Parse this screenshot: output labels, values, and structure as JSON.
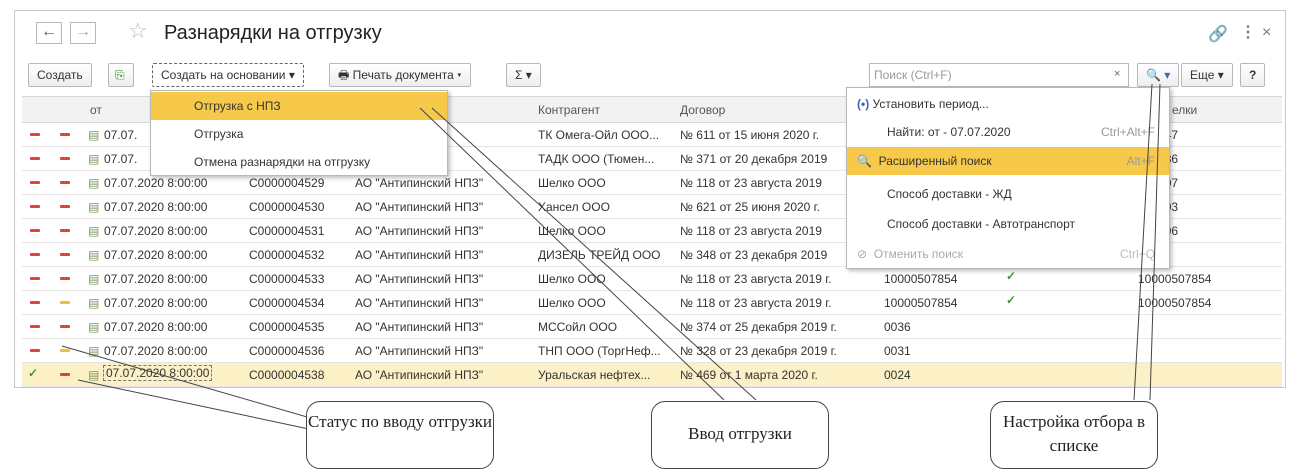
{
  "window": {
    "title": "Разнарядки на отгрузку"
  },
  "toolbar": {
    "create": "Создать",
    "create_based": "Создать на основании",
    "print": "Печать документа",
    "sum": "Σ",
    "more": "Еще",
    "help": "?"
  },
  "search": {
    "placeholder": "Поиск (Ctrl+F)"
  },
  "columns": {
    "date": "от",
    "contractor": "Контрагент",
    "contract": "Договор",
    "tail": "елки"
  },
  "rows": [
    {
      "date": "07.07.",
      "num": "",
      "org": "ский НПЗ\"",
      "contractor": "ТК Омега-Ойл ООО...",
      "contract": "№ 611 от 15 июня 2020 г.",
      "c1": "",
      "c2": "509347"
    },
    {
      "date": "07.07.",
      "num": "",
      "org": "ский НПЗ\"",
      "contractor": "ТАДК ООО (Тюмен...",
      "contract": "№ 371 от 20 декабря 2019",
      "c1": "",
      "c2": "510886"
    },
    {
      "date": "07.07.2020 8:00:00",
      "num": "C0000004529",
      "org": "АО \"Антипинский НПЗ\"",
      "contractor": "Шелко ООО",
      "contract": "№ 118 от 23 августа 2019",
      "c1": "",
      "c2": "506407"
    },
    {
      "date": "07.07.2020 8:00:00",
      "num": "C0000004530",
      "org": "АО \"Антипинский НПЗ\"",
      "contractor": "Хансел ООО",
      "contract": "№ 621 от 25 июня 2020 г.",
      "c1": "",
      "c2": "509003"
    },
    {
      "date": "07.07.2020 8:00:00",
      "num": "C0000004531",
      "org": "АО \"Антипинский НПЗ\"",
      "contractor": "Шелко ООО",
      "contract": "№ 118 от 23 августа 2019",
      "c1": "",
      "c2": "506496"
    },
    {
      "date": "07.07.2020 8:00:00",
      "num": "C0000004532",
      "org": "АО \"Антипинский НПЗ\"",
      "contractor": "ДИЗЕЛЬ ТРЕЙД ООО",
      "contract": "№ 348 от 23 декабря 2019",
      "c1": "",
      "c2": ""
    },
    {
      "date": "07.07.2020 8:00:00",
      "num": "C0000004533",
      "org": "АО \"Антипинский НПЗ\"",
      "contractor": "Шелко ООО",
      "contract": "№ 118 от 23 августа 2019 г.",
      "c1": "10000507854",
      "c2": "10000507854"
    },
    {
      "date": "07.07.2020 8:00:00",
      "num": "C0000004534",
      "org": "АО \"Антипинский НПЗ\"",
      "contractor": "Шелко ООО",
      "contract": "№ 118 от 23 августа 2019 г.",
      "c1": "10000507854",
      "c2": "10000507854"
    },
    {
      "date": "07.07.2020 8:00:00",
      "num": "C0000004535",
      "org": "АО \"Антипинский НПЗ\"",
      "contractor": "МССойл ООО",
      "contract": "№ 374 от 25 декабря 2019 г.",
      "c1": "0036",
      "c2": ""
    },
    {
      "date": "07.07.2020 8:00:00",
      "num": "C0000004536",
      "org": "АО \"Антипинский НПЗ\"",
      "contractor": "ТНП ООО (ТоргНеф...",
      "contract": "№ 328 от 23 декабря 2019 г.",
      "c1": "0031",
      "c2": ""
    },
    {
      "date": "07.07.2020 8:00:00",
      "num": "C0000004538",
      "org": "АО \"Антипинский НПЗ\"",
      "contractor": "Уральская нефтех...",
      "contract": "№ 469 от 1 марта 2020 г.",
      "c1": "0024",
      "c2": ""
    }
  ],
  "create_menu": [
    "Отгрузка с НПЗ",
    "Отгрузка",
    "Отмена разнарядки на отгрузку"
  ],
  "search_menu": {
    "period": "Установить период...",
    "find": "Найти: от - 07.07.2020",
    "find_key": "Ctrl+Alt+F",
    "advanced": "Расширенный поиск",
    "advanced_key": "Alt+F",
    "rail": "Способ доставки - ЖД",
    "auto": "Способ доставки - Автотранспорт",
    "cancel": "Отменить поиск",
    "cancel_key": "Ctrl+Q"
  },
  "callouts": {
    "status": "Статус по вводу отгрузки",
    "input": "Ввод отгрузки",
    "filter": "Настройка отбора в списке"
  },
  "colors": {
    "red": "#e0403a",
    "yellow": "#e8c040",
    "green": "#3a9a3a",
    "highlight": "#f6c94a"
  }
}
